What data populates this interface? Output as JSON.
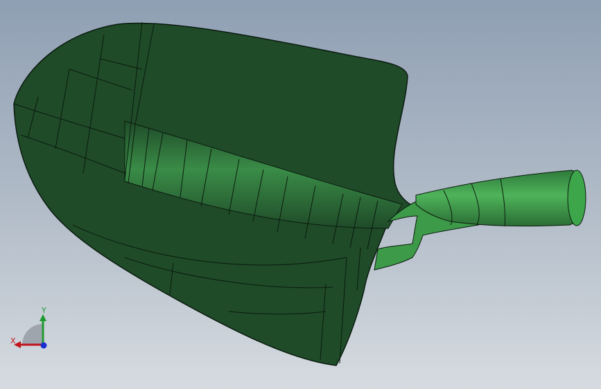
{
  "viewport": {
    "model_name": "shovel-head",
    "colors": {
      "background_top": "#8f9fb3",
      "background_bottom": "#d6dbe0",
      "blade_fill": "#1f4b29",
      "blade_highlight": "#2f7a3f",
      "handle_fill": "#3c9a48",
      "edge_color": "#0b1a0e"
    }
  },
  "triad": {
    "x_label": "X",
    "y_label": "Y",
    "colors": {
      "x": "#c0141a",
      "y": "#1f9a2f",
      "z": "#1a2fd0"
    }
  }
}
